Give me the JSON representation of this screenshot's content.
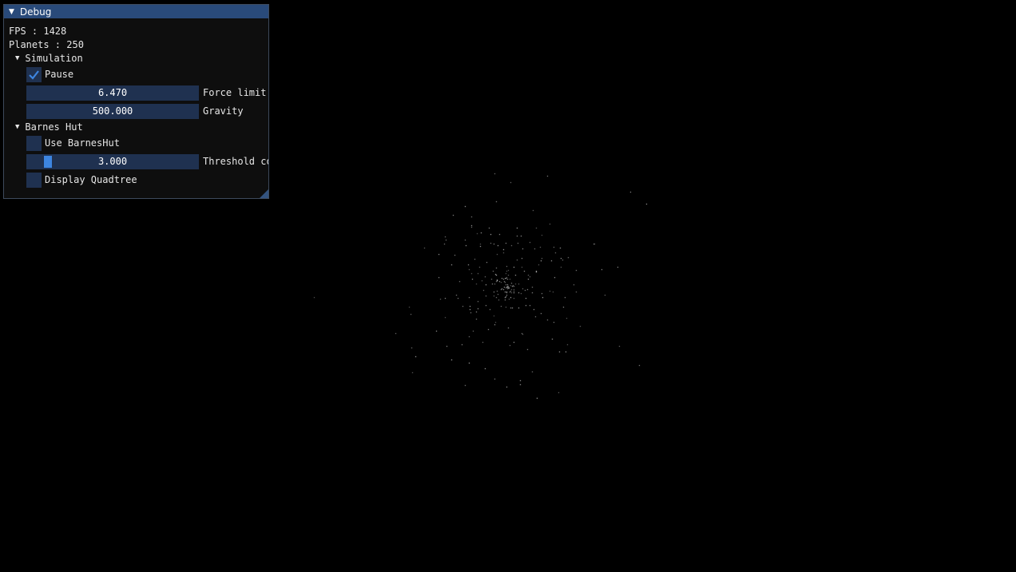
{
  "window": {
    "title": "Debug"
  },
  "stats": {
    "fps": "FPS : 1428",
    "planets": "Planets : 250"
  },
  "simulation": {
    "header": "Simulation",
    "pause": {
      "label": "Pause",
      "checked": true
    },
    "force_limit": {
      "value": "6.470",
      "label": "Force limit"
    },
    "gravity": {
      "value": "500.000",
      "label": "Gravity"
    }
  },
  "barnes_hut": {
    "header": "Barnes Hut",
    "use": {
      "label": "Use BarnesHut",
      "checked": false
    },
    "threshold": {
      "value": "3.000",
      "label": "Threshold coefficient",
      "fraction": 0.1
    },
    "display_quadtree": {
      "label": "Display Quadtree",
      "checked": false
    }
  },
  "colors": {
    "title_bar": "#294a7a",
    "frame_bg": "#1f3150",
    "check_mark": "#3d85e0",
    "window_bg": "#0f0f0f",
    "planet": "#ffffff"
  },
  "icons": {
    "collapse": "triangle-down-icon",
    "check": "check-icon",
    "resize": "resize-grip-icon"
  }
}
